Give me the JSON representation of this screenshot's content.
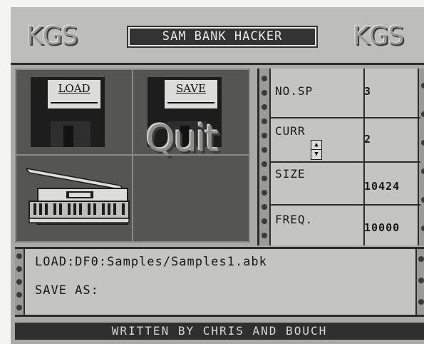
{
  "header": {
    "logo_left": "KGS",
    "title": "SAM BANK HACKER",
    "logo_right": "KGS"
  },
  "buttons": {
    "load": "LOAD",
    "save": "SAVE",
    "quit": "Quit"
  },
  "stats": {
    "no_sp_label": "NO.SP",
    "no_sp_value": "3",
    "curr_label": "CURR",
    "curr_value": "2",
    "size_label": "SIZE",
    "size_value": "10424",
    "freq_label": "FREQ.",
    "freq_value": "10000"
  },
  "files": {
    "load_path": "LOAD:DF0:Samples/Samples1.abk",
    "save_as": "SAVE AS:"
  },
  "footer": {
    "credit": "WRITTEN BY CHRIS AND BOUCH"
  }
}
